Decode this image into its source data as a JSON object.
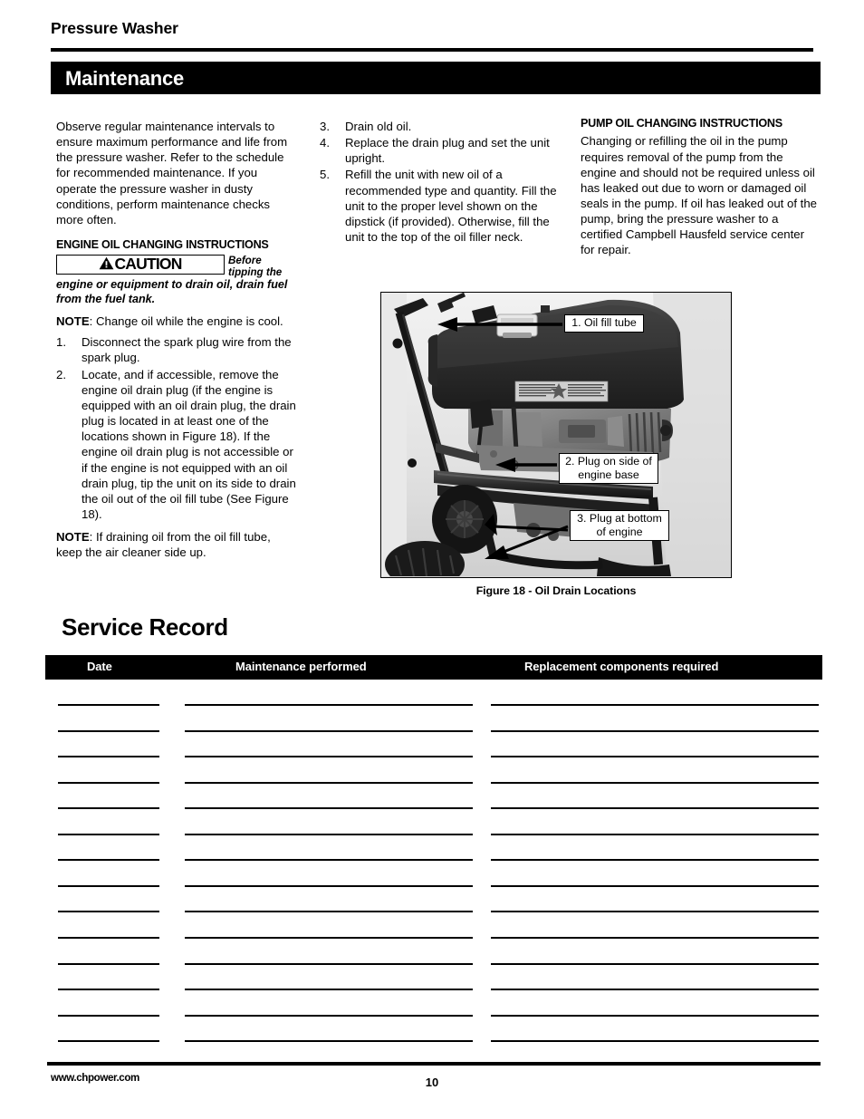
{
  "header": {
    "title": "Pressure Washer"
  },
  "section": {
    "banner_label": "Maintenance"
  },
  "column_left": {
    "intro": "Observe regular maintenance intervals to ensure maximum performance and life from the pressure washer. Refer to the schedule for recommended maintenance. If you operate the pressure washer in dusty conditions, perform maintenance checks more often.",
    "engine_oil_heading": "ENGINE OIL CHANGING INSTRUCTIONS",
    "caution_label": "CAUTION",
    "caution_lead": "Before tipping the",
    "caution_tail": "engine or equipment to drain oil, drain fuel from the fuel tank.",
    "note1_label": "NOTE",
    "note1_text": ": Change oil while the engine is cool.",
    "steps": [
      {
        "num": "1.",
        "text": "Disconnect the spark plug wire from the spark plug."
      },
      {
        "num": "2.",
        "text": "Locate, and if accessible, remove the engine oil drain plug (if the engine is equipped with an oil drain plug, the drain plug is located in at least one of the locations shown in Figure 18). If the engine oil drain plug is not accessible or if the engine is not equipped with an oil drain plug, tip the unit on its side to drain the oil out of the oil fill tube (See Figure 18)."
      }
    ],
    "note2_label": "NOTE",
    "note2_text": ": If draining oil from the oil fill tube, keep the air cleaner side up."
  },
  "column_middle": {
    "steps": [
      {
        "num": "3.",
        "text": "Drain old oil."
      },
      {
        "num": "4.",
        "text": "Replace the drain plug and set the unit upright."
      },
      {
        "num": "5.",
        "text": "Refill the unit with new oil of a recommended type and quantity. Fill the unit to the proper level shown on the dipstick (if provided). Otherwise, fill the unit to the top of the oil filler neck."
      }
    ]
  },
  "column_right": {
    "pump_oil_heading": "PUMP OIL CHANGING INSTRUCTIONS",
    "pump_oil_text": "Changing or refilling the oil in the pump requires removal of the pump from the engine and should not be required unless oil has leaked out due to worn or damaged oil seals in the pump. If oil has leaked out of the pump, bring the pressure washer to a certified Campbell Hausfeld service center for repair."
  },
  "figure": {
    "caption": "Figure 18 - Oil Drain Locations",
    "callouts": [
      {
        "id": "1",
        "text": "1. Oil fill tube"
      },
      {
        "id": "2",
        "text": "2. Plug on side of\nengine base"
      },
      {
        "id": "3",
        "text": "3. Plug at bottom\nof engine"
      }
    ],
    "alt": "Photograph of a pressure washer engine on a wheeled frame showing oil drain locations"
  },
  "service_record": {
    "title": "Service Record",
    "columns": [
      "Date",
      "Maintenance performed",
      "Replacement components required"
    ],
    "blank_row_count": 14,
    "rows": [
      {
        "date": "",
        "maintenance": "",
        "replacement": ""
      },
      {
        "date": "",
        "maintenance": "",
        "replacement": ""
      },
      {
        "date": "",
        "maintenance": "",
        "replacement": ""
      },
      {
        "date": "",
        "maintenance": "",
        "replacement": ""
      },
      {
        "date": "",
        "maintenance": "",
        "replacement": ""
      },
      {
        "date": "",
        "maintenance": "",
        "replacement": ""
      },
      {
        "date": "",
        "maintenance": "",
        "replacement": ""
      },
      {
        "date": "",
        "maintenance": "",
        "replacement": ""
      },
      {
        "date": "",
        "maintenance": "",
        "replacement": ""
      },
      {
        "date": "",
        "maintenance": "",
        "replacement": ""
      },
      {
        "date": "",
        "maintenance": "",
        "replacement": ""
      },
      {
        "date": "",
        "maintenance": "",
        "replacement": ""
      },
      {
        "date": "",
        "maintenance": "",
        "replacement": ""
      },
      {
        "date": "",
        "maintenance": "",
        "replacement": ""
      }
    ]
  },
  "footer": {
    "website": "www.chpower.com",
    "page_number": "10"
  },
  "colors": {
    "ink": "#000000",
    "paper": "#ffffff",
    "banner_bg": "#000000",
    "banner_text": "#ffffff"
  }
}
